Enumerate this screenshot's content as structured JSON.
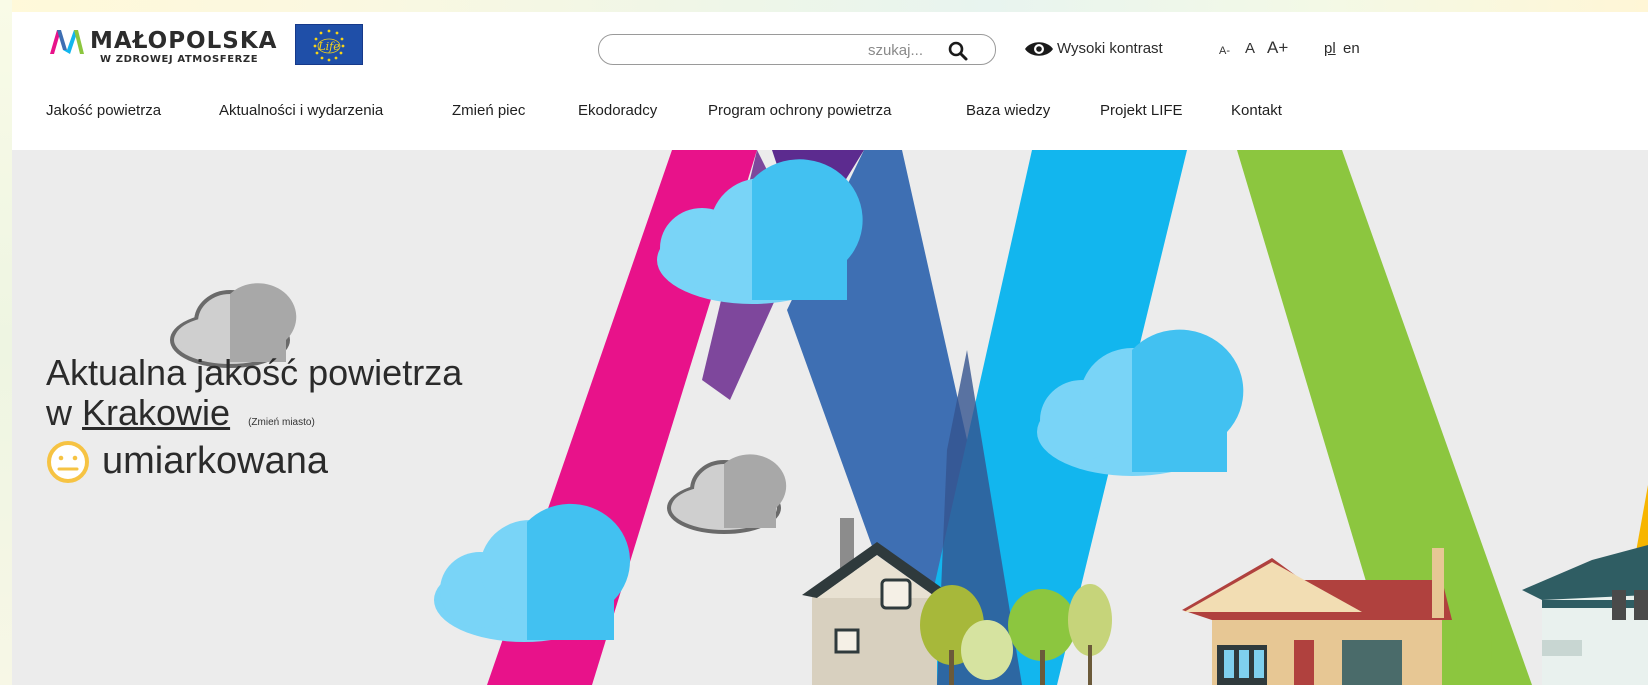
{
  "header": {
    "logo_title": "MAŁOPOLSKA",
    "logo_subtitle": "W ZDROWEJ ATMOSFERZE",
    "life_label": "Life",
    "search": {
      "placeholder": "szukaj..."
    },
    "contrast_label": "Wysoki kontrast",
    "font_sizes": {
      "small": "A-",
      "normal": "A",
      "large": "A+"
    },
    "languages": {
      "pl": "pl",
      "en": "en"
    }
  },
  "nav": {
    "items": [
      {
        "label": "Jakość powietrza"
      },
      {
        "label": "Aktualności i wydarzenia"
      },
      {
        "label": "Zmień piec"
      },
      {
        "label": "Ekodoradcy"
      },
      {
        "label": "Program ochrony powietrza"
      },
      {
        "label": "Baza wiedzy"
      },
      {
        "label": "Projekt LIFE"
      },
      {
        "label": "Kontakt"
      }
    ]
  },
  "hero": {
    "title_line1": "Aktualna jakość powietrza",
    "title_prefix": "w",
    "city": "Krakowie",
    "change_city": "(Zmień miasto)",
    "status": "umiarkowana",
    "status_color": "#f6c343"
  },
  "colors": {
    "stripe_pink": "#e8128a",
    "stripe_purple": "#5c2b8f",
    "stripe_blue": "#3e6fb3",
    "stripe_cyan": "#12b6ee",
    "stripe_green": "#8cc63f",
    "stripe_yellow": "#f7b500",
    "flag_blue": "#1f4fa8"
  }
}
